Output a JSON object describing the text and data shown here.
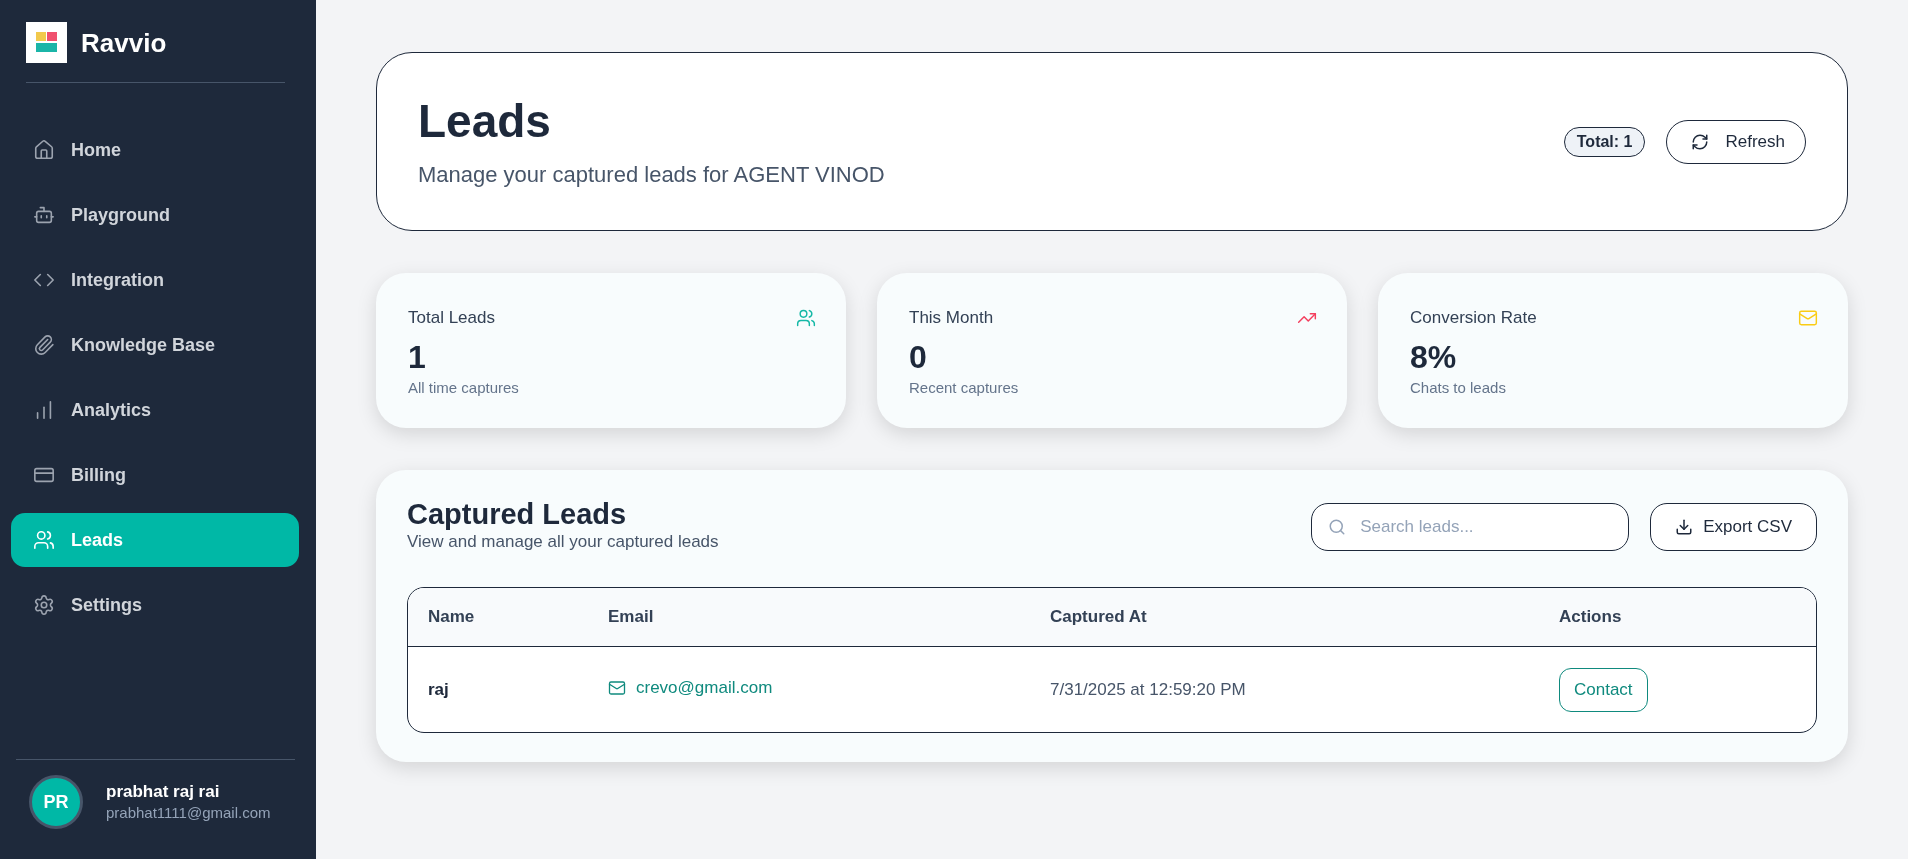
{
  "sidebar": {
    "brand": "Ravvio",
    "nav": [
      {
        "label": "Home",
        "selected": false
      },
      {
        "label": "Playground",
        "selected": false
      },
      {
        "label": "Integration",
        "selected": false
      },
      {
        "label": "Knowledge Base",
        "selected": false
      },
      {
        "label": "Analytics",
        "selected": false
      },
      {
        "label": "Billing",
        "selected": false
      },
      {
        "label": "Leads",
        "selected": true
      },
      {
        "label": "Settings",
        "selected": false
      }
    ],
    "user": {
      "initials": "PR",
      "name": "prabhat raj rai",
      "email": "prabhat1111@gmail.com"
    }
  },
  "header": {
    "title": "Leads",
    "subtitle": "Manage your captured leads for AGENT VINOD",
    "total_badge": "Total: 1",
    "refresh_button": "Refresh"
  },
  "stats": [
    {
      "label": "Total Leads",
      "value": "1",
      "caption": "All time captures",
      "color": "#14b8a6"
    },
    {
      "label": "This Month",
      "value": "0",
      "caption": "Recent captures",
      "color": "#f43f5e"
    },
    {
      "label": "Conversion Rate",
      "value": "8%",
      "caption": "Chats to leads",
      "color": "#facc15"
    }
  ],
  "leads_table": {
    "title": "Captured Leads",
    "subtitle": "View and manage all your captured leads",
    "search": {
      "placeholder": "Search leads..."
    },
    "export_button": "Export CSV",
    "columns": [
      "Name",
      "Email",
      "Captured At",
      "Actions"
    ],
    "rows": [
      {
        "name": "raj",
        "email": "crevo@gmail.com",
        "captured_at": "7/31/2025 at 12:59:20 PM",
        "action": "Contact"
      }
    ]
  }
}
